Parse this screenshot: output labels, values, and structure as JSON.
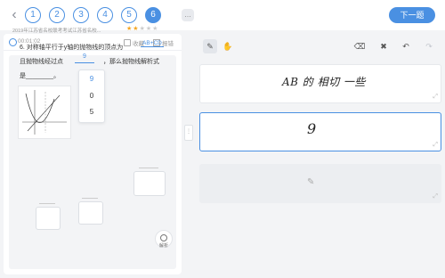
{
  "topbar": {
    "question_numbers": [
      "1",
      "2",
      "3",
      "4",
      "5",
      "6"
    ],
    "active_index": 5,
    "more_label": "...",
    "next_button": "下一题"
  },
  "left_panel": {
    "timer": "00:01:02",
    "favorite_label": "收藏",
    "error_label": "报错",
    "source": "2019年江苏省名校联考考试江苏省名校...",
    "difficulty_stars": 2,
    "difficulty_max": 5,
    "question": {
      "line1": "6. 对称轴平行于y轴的抛物线的顶点为",
      "answer_chip": "AB+CD",
      "line2a": "且抛物线经过点",
      "blank_value": "9",
      "line2b": "，那么抛物线解析式",
      "line3": "是________。"
    },
    "dropdown_options": [
      "9",
      "0",
      "5"
    ],
    "dropdown_selected": 0,
    "explain_label": "解析"
  },
  "right_panel": {
    "tools": [
      "pen-icon",
      "hand-icon",
      "eraser-icon",
      "clear-icon",
      "undo-icon",
      "redo-icon"
    ],
    "answers": [
      {
        "text": "AB 的 相切 一些"
      },
      {
        "text": "9"
      },
      {
        "text": ""
      }
    ]
  }
}
